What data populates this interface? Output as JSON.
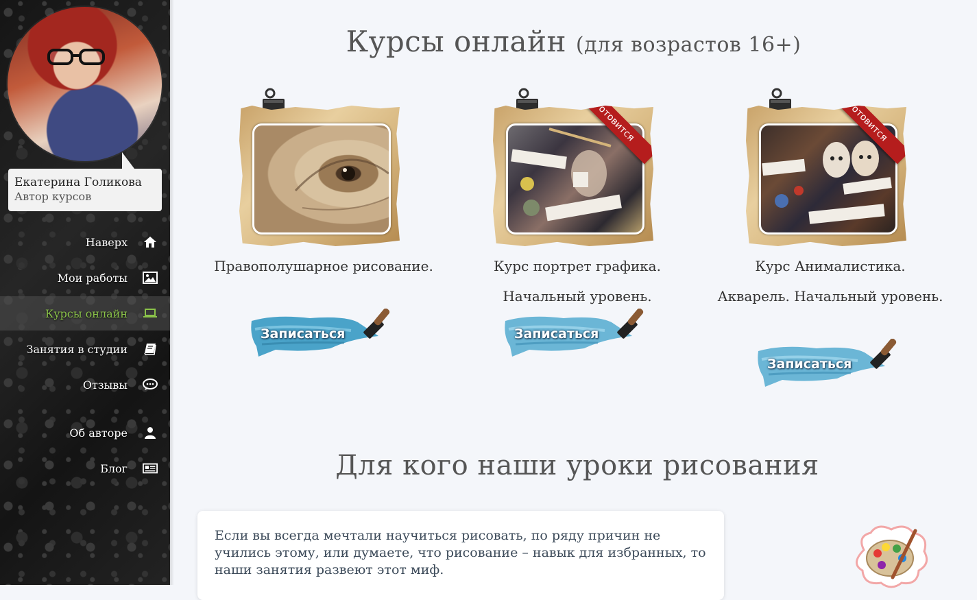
{
  "sidebar": {
    "profile": {
      "name": "Екатерина Голикова",
      "role": "Автор курсов"
    },
    "nav": [
      {
        "label": "Наверх",
        "icon": "home-icon",
        "active": false
      },
      {
        "label": "Мои работы",
        "icon": "image-icon",
        "active": false
      },
      {
        "label": "Курсы онлайн",
        "icon": "laptop-icon",
        "active": true
      },
      {
        "label": "Занятия в студии",
        "icon": "book-icon",
        "active": false
      },
      {
        "label": "Отзывы",
        "icon": "chat-icon",
        "active": false
      },
      {
        "label": "Об авторе",
        "icon": "user-icon",
        "active": false
      },
      {
        "label": "Блог",
        "icon": "newspaper-icon",
        "active": false
      }
    ],
    "active_color": "#8bc34a"
  },
  "courses_section": {
    "title": "Курсы онлайн",
    "subtitle": "(для возрастов 16+)"
  },
  "courses": [
    {
      "title": "Правополушарное рисование.",
      "ribbon": "",
      "enroll_label": "Записаться"
    },
    {
      "title": "Курс портрет графика. Начальный уровень.",
      "ribbon": "Готовится",
      "enroll_label": "Записаться"
    },
    {
      "title": "Курс Анималистика. Акварель. Начальный уровень.",
      "ribbon": "Готовится",
      "enroll_label": "Записаться"
    }
  ],
  "audience_section": {
    "title": "Для кого наши уроки рисования",
    "text": "Если вы всегда мечтали научиться рисовать, по ряду причин не учились этому, или думаете, что рисование – навык для избранных, то наши занятия развеют этот миф."
  },
  "colors": {
    "ribbon": "#b51d1d",
    "brush_blue": "#4aa3c9",
    "page_bg": "#f4f6fa"
  }
}
